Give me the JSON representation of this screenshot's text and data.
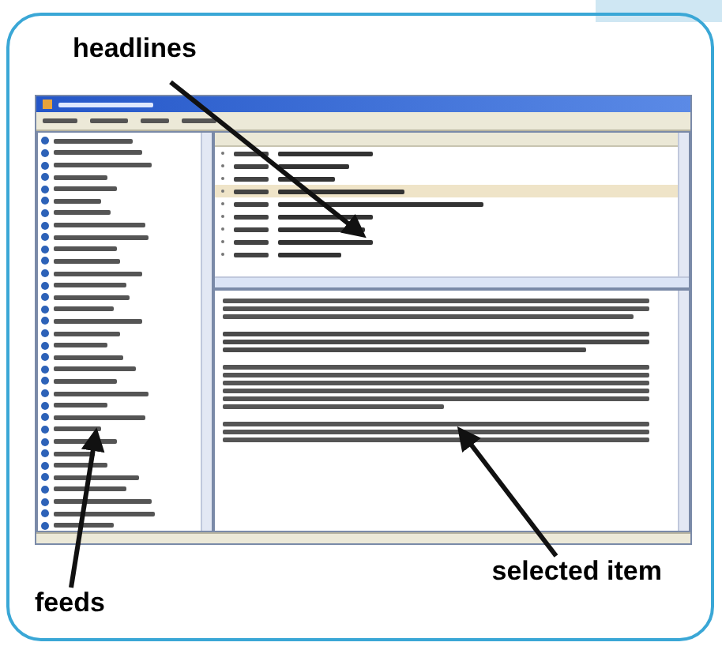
{
  "callouts": [
    {
      "label": "headlines"
    },
    {
      "label": "feeds"
    },
    {
      "label": "selected item"
    }
  ],
  "headline_rows": [
    {
      "selected": false
    },
    {
      "selected": false
    },
    {
      "selected": false
    },
    {
      "selected": true
    },
    {
      "selected": false
    },
    {
      "selected": false
    },
    {
      "selected": false
    },
    {
      "selected": false
    },
    {
      "selected": false
    }
  ]
}
